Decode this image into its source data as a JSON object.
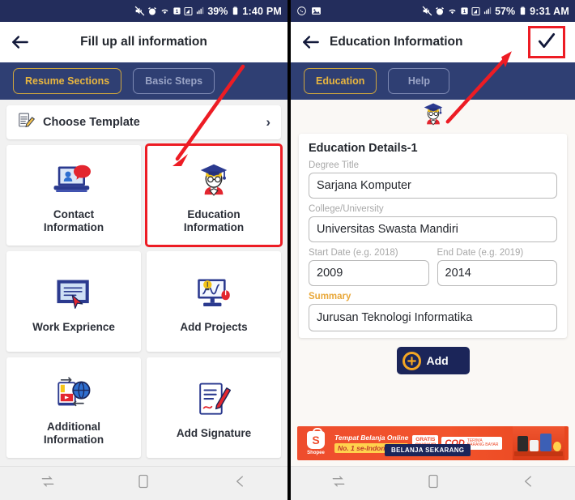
{
  "left": {
    "status": {
      "time": "1:40 PM",
      "battery_pct": "39%",
      "icons": [
        "mute-icon",
        "alarm-icon",
        "wifi-icon",
        "sim1-icon",
        "signal-icon",
        "battery-icon"
      ]
    },
    "appbar": {
      "title": "Fill up all information",
      "back_icon": "back-arrow-icon"
    },
    "tabs": [
      {
        "label": "Resume Sections",
        "active": true
      },
      {
        "label": "Basic Steps",
        "active": false
      }
    ],
    "template_row": {
      "label": "Choose Template",
      "icon": "note-pencil-icon",
      "chevron": "›"
    },
    "grid": [
      {
        "label": "Contact\nInformation",
        "icon": "laptop-contact-icon",
        "highlighted": false
      },
      {
        "label": "Education\nInformation",
        "icon": "graduate-icon",
        "highlighted": true
      },
      {
        "label": "Work Exprience",
        "icon": "document-cursor-icon",
        "highlighted": false
      },
      {
        "label": "Add Projects",
        "icon": "monitor-idea-icon",
        "highlighted": false
      },
      {
        "label": "Additional\nInformation",
        "icon": "book-globe-icon",
        "highlighted": false
      },
      {
        "label": "Add Signature",
        "icon": "signature-icon",
        "highlighted": false
      }
    ],
    "navbar": [
      "recents-icon",
      "home-icon",
      "back-icon"
    ]
  },
  "right": {
    "status": {
      "time": "9:31 AM",
      "battery_pct": "57%",
      "left_icons": [
        "whatsapp-icon",
        "screenshot-icon"
      ],
      "icons": [
        "mute-icon",
        "alarm-icon",
        "wifi-icon",
        "sim1-icon",
        "signal-icon",
        "battery-icon"
      ]
    },
    "appbar": {
      "title": "Education Information",
      "back_icon": "back-arrow-icon",
      "confirm_icon": "check-icon"
    },
    "tabs": [
      {
        "label": "Education",
        "active": true
      },
      {
        "label": "Help",
        "active": false
      }
    ],
    "avatar_icon": "graduate-icon",
    "form": {
      "title": "Education Details-1",
      "fields": [
        {
          "label": "Degree Title",
          "value": "Sarjana Komputer"
        },
        {
          "label": "College/University",
          "value": "Universitas Swasta Mandiri"
        },
        {
          "label": "Start Date (e.g. 2018)",
          "value": "2009"
        },
        {
          "label": "End Date (e.g. 2019)",
          "value": "2014"
        },
        {
          "label": "Summary",
          "value": "Jurusan Teknologi Informatika"
        }
      ]
    },
    "add_button": {
      "label": "Add",
      "icon": "plus-circle-icon"
    },
    "ad": {
      "brand": "Shopee",
      "line1": "Tempat Belanja Online",
      "line2": "No. 1 se-Indonesia",
      "badge_free": "GRATIS ONGKIR",
      "badge_cod": "COD",
      "badge_cod_sub": "TERIMA BARANG BAYAR",
      "cta": "BELANJA SEKARANG"
    },
    "navbar": [
      "recents-icon",
      "home-icon",
      "back-icon"
    ]
  },
  "annotations": {
    "left_arrow": {
      "color": "#ed1c24",
      "points_to": "Education Information"
    },
    "right_arrow": {
      "color": "#ed1c24",
      "points_to": "check-icon"
    },
    "highlight_color": "#ed1c24"
  }
}
